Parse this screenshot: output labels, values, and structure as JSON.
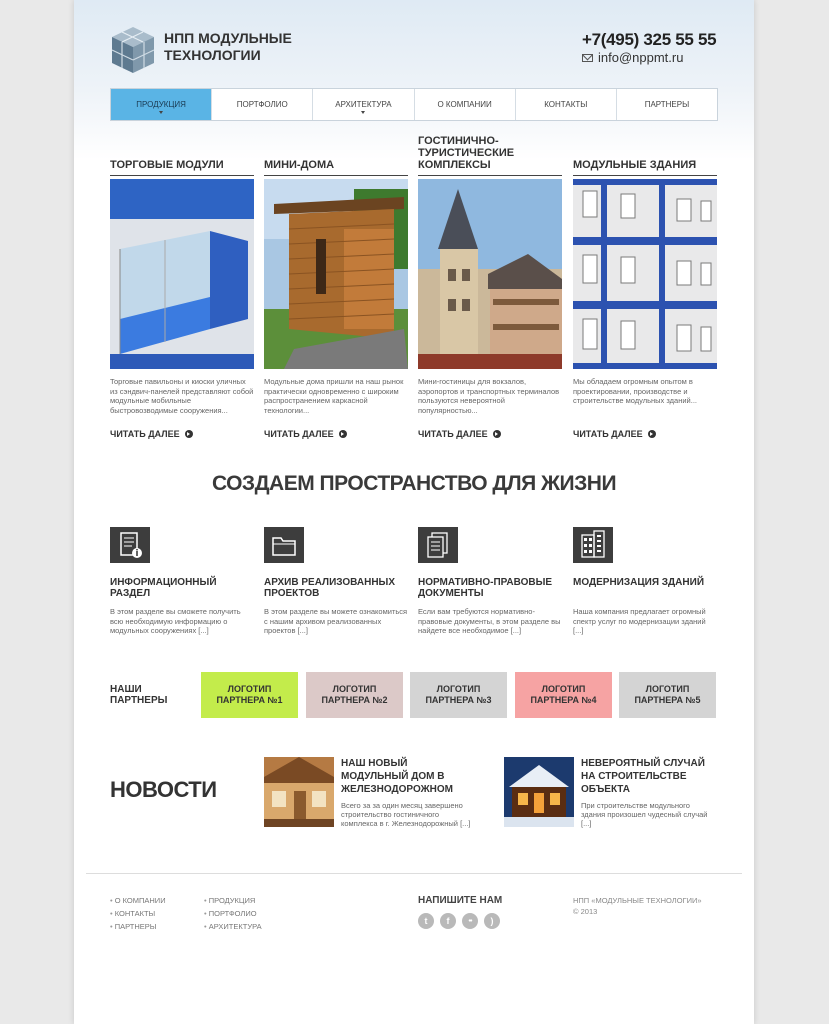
{
  "header": {
    "logo_line1": "НПП МОДУЛЬНЫЕ",
    "logo_line2": "ТЕХНОЛОГИИ",
    "phone": "+7(495) 325 55 55",
    "email": "info@nppmt.ru"
  },
  "nav": [
    {
      "label": "Продукция",
      "active": true,
      "dropdown": true
    },
    {
      "label": "Портфолио",
      "active": false,
      "dropdown": false
    },
    {
      "label": "Архитектура",
      "active": false,
      "dropdown": true
    },
    {
      "label": "О компании",
      "active": false,
      "dropdown": false
    },
    {
      "label": "Контакты",
      "active": false,
      "dropdown": false
    },
    {
      "label": "Партнеры",
      "active": false,
      "dropdown": false
    }
  ],
  "products": [
    {
      "title": "ТОРГОВЫЕ МОДУЛИ",
      "desc": "Торговые павильоны и киоски уличных из сэндвич-панелей представляют собой модульные мобильные быстровозводимые сооружения...",
      "more": "ЧИТАТЬ ДАЛЕЕ"
    },
    {
      "title": "МИНИ-ДОМА",
      "desc": "Модульные дома пришли на наш рынок практически одновременно с широким распространением каркасной технологии...",
      "more": "ЧИТАТЬ ДАЛЕЕ"
    },
    {
      "title": "ГОСТИНИЧНО-ТУРИСТИЧЕСКИЕ КОМПЛЕКСЫ",
      "desc": "Мини-гостиницы для вокзалов, аэропортов и транспортных терминалов пользуются невероятной популярностью...",
      "more": "ЧИТАТЬ ДАЛЕЕ"
    },
    {
      "title": "МОДУЛЬНЫЕ ЗДАНИЯ",
      "desc": "Мы обладаем огромным опытом в проектировании, производстве и строительстве модульных зданий...",
      "more": "ЧИТАТЬ ДАЛЕЕ"
    }
  ],
  "slogan": "СОЗДАЕМ ПРОСТРАНСТВО ДЛЯ ЖИЗНИ",
  "features": [
    {
      "title": "ИНФОРМАЦИОННЫЙ РАЗДЕЛ",
      "desc": "В этом разделе вы сможете получить всю необходимую информацию о модульных сооружениях [...]",
      "icon": "document-info-icon"
    },
    {
      "title": "АРХИВ РЕАЛИЗОВАННЫХ ПРОЕКТОВ",
      "desc": "В этом разделе вы можете ознакомиться с нашим архивом реализованных проектов [...]",
      "icon": "folder-icon"
    },
    {
      "title": "НОРМАТИВНО-ПРАВОВЫЕ ДОКУМЕНТЫ",
      "desc": "Если вам требуются нормативно-правовые документы, в этом разделе вы найдете все необходимое [...]",
      "icon": "documents-icon"
    },
    {
      "title": "МОДЕРНИЗАЦИЯ ЗДАНИЙ",
      "desc": "Наша компания предлагает огромный спектр услуг по модернизации зданий [...]",
      "icon": "building-icon"
    }
  ],
  "partners": {
    "label_line1": "НАШИ",
    "label_line2": "ПАРТНЕРЫ",
    "items": [
      {
        "line1": "ЛОГОТИП",
        "line2": "ПАРТНЕРА №1",
        "color": "#c3ec4b"
      },
      {
        "line1": "ЛОГОТИП",
        "line2": "ПАРТНЕРА №2",
        "color": "#dcc9c8"
      },
      {
        "line1": "ЛОГОТИП",
        "line2": "ПАРТНЕРА №3",
        "color": "#d4d4d4"
      },
      {
        "line1": "ЛОГОТИП",
        "line2": "ПАРТНЕРА №4",
        "color": "#f6a3a3"
      },
      {
        "line1": "ЛОГОТИП",
        "line2": "ПАРТНЕРА №5",
        "color": "#d4d4d4"
      }
    ]
  },
  "news": {
    "title": "НОВОСТИ",
    "items": [
      {
        "headline": "НАШ НОВЫЙ МОДУЛЬНЫЙ ДОМ В ЖЕЛЕЗНОДОРОЖНОМ",
        "text": "Всего за за один месяц завершено строительство гостиничного комплекса в г. Железнодорожный [...]"
      },
      {
        "headline": "НЕВЕРОЯТНЫЙ СЛУЧАЙ НА СТРОИТЕЛЬСТВЕ ОБЪЕКТА",
        "text": "При строительстве модульного здания произошел чудесный случай [...]"
      }
    ]
  },
  "footer": {
    "col1": [
      "О КОМПАНИИ",
      "КОНТАКТЫ",
      "ПАРТНЕРЫ"
    ],
    "col2": [
      "ПРОДУКЦИЯ",
      "ПОРТФОЛИО",
      "АРХИТЕКТУРА"
    ],
    "write_us": "НАПИШИТЕ НАМ",
    "social": [
      {
        "icon": "twitter-icon",
        "glyph": "t"
      },
      {
        "icon": "facebook-icon",
        "glyph": "f"
      },
      {
        "icon": "flickr-icon",
        "glyph": "••"
      },
      {
        "icon": "rss-icon",
        "glyph": ")"
      }
    ],
    "copyright_line1": "НПП «МОДУЛЬНЫЕ ТЕХНОЛОГИИ»",
    "copyright_line2": "© 2013"
  }
}
